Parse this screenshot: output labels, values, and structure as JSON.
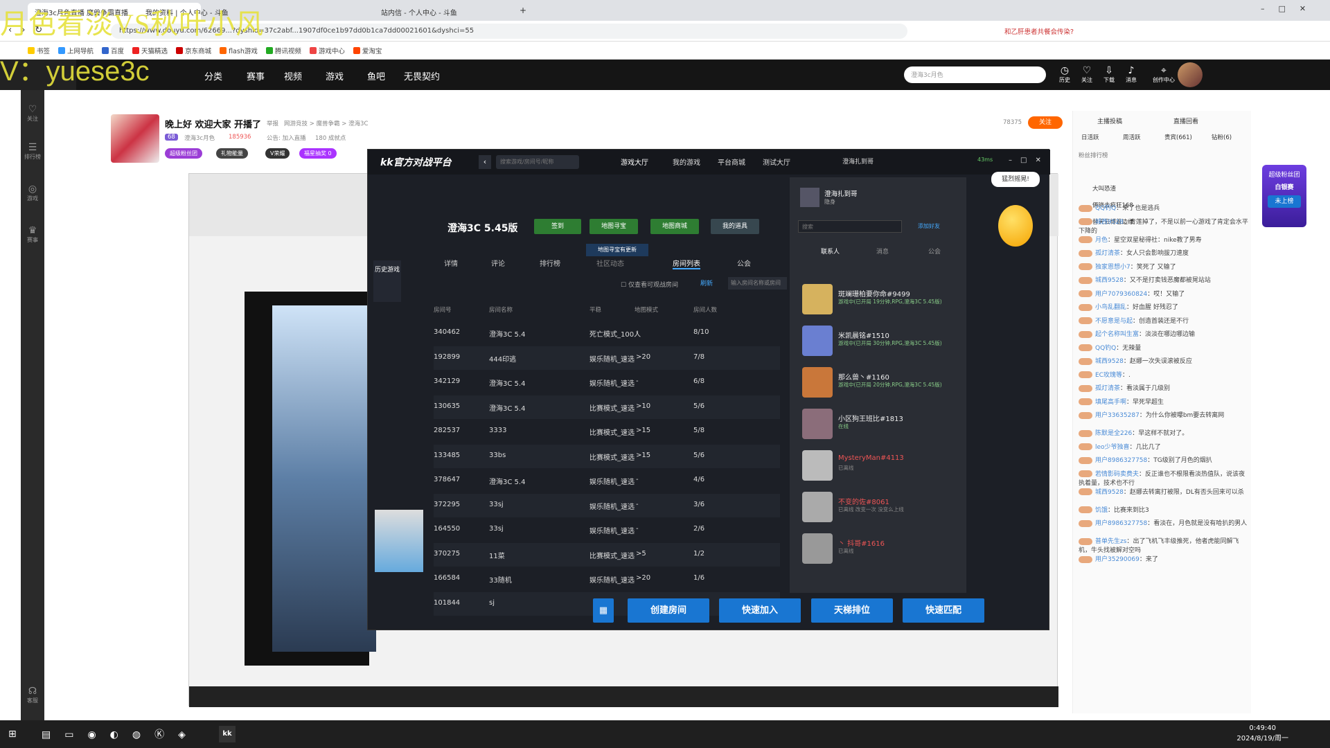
{
  "watermark": {
    "line1": "月色看淡VS秋叶小风",
    "line2": "V：yuese3c"
  },
  "browser": {
    "tabs": [
      "澄海3c月色直播 魔兽争霸直播",
      "我的资料 | 个人中心 - 斗鱼",
      "站内信 - 个人中心 - 斗鱼"
    ],
    "url": "https://www.douyu.com/62669...?dyshid=37c2abf...1907df0ce1b97dd0b1ca7dd00021601&dyshci=55",
    "bookmarks": [
      "书签",
      "上网导航",
      "百度",
      "天猫精选",
      "京东商城",
      "flash游戏",
      "腾讯视频",
      "游戏中心",
      "爱淘宝"
    ],
    "notice": "和乙肝患者共餐会传染?"
  },
  "douyu": {
    "nav": [
      "分类",
      "赛事",
      "视频",
      "游戏",
      "鱼吧",
      "无畏契约"
    ],
    "search_placeholder": "澄海3c月色",
    "header_icons": [
      "历史",
      "关注",
      "下载",
      "消息",
      "创作中心"
    ],
    "left_rail": [
      "关注",
      "排行榜",
      "游戏",
      "赛事",
      "客服"
    ]
  },
  "room": {
    "title": "晚上好 欢迎大家 开播了",
    "report": "举报",
    "category": "网游竞技 > 魔兽争霸 > 澄海3C",
    "level": "68",
    "streamer": "澄海3c月色",
    "hot": "185936",
    "notice": "公告: 加入直播",
    "fans_count": "180 成就点",
    "followers": "78375",
    "follow_btn": "关注",
    "badges": [
      "超级粉丝团",
      "礼物能量",
      "V荣耀",
      "福星抽奖 0"
    ]
  },
  "kk": {
    "logo": "kk官方对战平台",
    "search": "搜索游戏/房间号/昵称",
    "nav": [
      "游戏大厅",
      "我的游戏",
      "平台商城",
      "测试大厅"
    ],
    "user": "澄海扎到哥",
    "ping": "43ms",
    "side_label": "历史游戏",
    "game_title": "澄海3C 5.45版",
    "buttons": [
      "签到",
      "地图寻宝",
      "地图商城",
      "我的道具"
    ],
    "tooltip": "地图寻宝有更新",
    "tabs": [
      "详情",
      "评论",
      "排行榜",
      "社区动态",
      "房间列表",
      "公会"
    ],
    "filter_label": "仅查看可观战房间",
    "refresh": "刷新",
    "filter_input": "输入房间名称或房间",
    "columns": [
      "房间号",
      "房间名称",
      "平稳",
      "地图模式",
      "房间人数",
      "房间号"
    ],
    "rooms": [
      {
        "id": "340462",
        "name": "澄海3C 5.4",
        "mode": "死亡模式_100人",
        "req": "-",
        "count": "8/10"
      },
      {
        "id": "192899",
        "name": "444印逃",
        "mode": "娱乐随机_速选",
        "req": ">20",
        "count": "7/8"
      },
      {
        "id": "342129",
        "name": "澄海3C 5.4",
        "mode": "娱乐随机_速选",
        "req": "-",
        "count": "6/8"
      },
      {
        "id": "130635",
        "name": "澄海3C 5.4",
        "mode": "比赛模式_速选",
        "req": ">10",
        "count": "5/6"
      },
      {
        "id": "282537",
        "name": "3333",
        "mode": "比赛模式_速选",
        "req": ">15",
        "count": "5/8"
      },
      {
        "id": "133485",
        "name": "33bs",
        "mode": "比赛模式_速选",
        "req": ">15",
        "count": "5/6"
      },
      {
        "id": "378647",
        "name": "澄海3C 5.4",
        "mode": "娱乐随机_速选",
        "req": "-",
        "count": "4/6"
      },
      {
        "id": "372295",
        "name": "33sj",
        "mode": "娱乐随机_速选",
        "req": "-",
        "count": "3/6"
      },
      {
        "id": "164550",
        "name": "33sj",
        "mode": "娱乐随机_速选",
        "req": "-",
        "count": "2/6"
      },
      {
        "id": "370275",
        "name": "11菜",
        "mode": "比赛模式_速选",
        "req": ">5",
        "count": "1/2"
      },
      {
        "id": "166584",
        "name": "33随机",
        "mode": "娱乐随机_速选",
        "req": ">20",
        "count": "1/6"
      },
      {
        "id": "101844",
        "name": "sj",
        "mode": "",
        "req": "",
        "count": ""
      }
    ],
    "actions": [
      "创建房间",
      "快速加入",
      "天梯排位",
      "快速匹配"
    ],
    "friends_panel": {
      "user": "澄海扎到哥",
      "status": "隐身",
      "search": "搜索",
      "add": "添加好友",
      "tabs": [
        "联系人",
        "消息",
        "公会"
      ],
      "bubble": "猛烈摇晃!",
      "friends": [
        {
          "name": "斑斓珊柏要你命#9499",
          "status": "游戏中(已开局 19分钟,RPG,澄海3C 5.45版)",
          "online": true
        },
        {
          "name": "米凯晨铭#1510",
          "status": "游戏中(已开局 30分钟,RPG,澄海3C 5.45版)",
          "online": true
        },
        {
          "name": "那么兽丶#1160",
          "status": "游戏中(已开局 20分钟,RPG,澄海3C 5.45版)",
          "online": true
        },
        {
          "name": "小区狗王班比#1813",
          "status": "在线",
          "online": true
        },
        {
          "name": "MysteryMan#4113",
          "status": "已离线",
          "online": false
        },
        {
          "name": "不变的佐#8061",
          "status": "已离线 改变一次 没变么上线",
          "online": false
        },
        {
          "name": "丶 抖哥#1616",
          "status": "已离线",
          "online": false
        }
      ]
    }
  },
  "right": {
    "tabs": [
      "日活跃",
      "周活跃",
      "贵宾(661)",
      "钻粉(6)"
    ],
    "ranks": [
      "主播投稿",
      "直播回看"
    ],
    "rank_title": "粉丝排行榜",
    "rank_list": [
      "大叫恐渣",
      "俩晓去疯狂168",
      "替天云博着边缘"
    ],
    "promo": [
      "超级粉丝团",
      "白银赛",
      "未上榜"
    ],
    "chat": [
      {
        "name": "QQ钓Q",
        "msg": "来了也是逃兵"
      },
      {
        "name": "城西9528",
        "msg": "青莲掉了，不是以前一心游戏了肯定会水平下降的"
      },
      {
        "name": "月色",
        "msg": "星空双星秘得社：nike教了男寿"
      },
      {
        "name": "孤灯清茶",
        "msg": "女人只会影响拔刀速度"
      },
      {
        "name": "独家恩想小7",
        "msg": "笑死了 又输了"
      },
      {
        "name": "城西9528",
        "msg": "又不是打卖钱恶魔都被晃站站"
      },
      {
        "name": "用户7079360824",
        "msg": "哎！又输了"
      },
      {
        "name": "小鸟乱翻乱",
        "msg": "好血腥 好残忍了"
      },
      {
        "name": "不愿意是与起",
        "msg": "创造首装还是不行"
      },
      {
        "name": "起个名称叫生富",
        "msg": "淡淡在哪边哪边输"
      },
      {
        "name": "QQ钓Q",
        "msg": "无辣量"
      },
      {
        "name": "城西9528",
        "msg": "赵娜一次失误滚被反应"
      },
      {
        "name": "EC玫瑰等",
        "msg": "."
      },
      {
        "name": "孤灯清茶",
        "msg": "看淡属于几级别"
      },
      {
        "name": "填尾高手啊",
        "msg": "早死早超生"
      },
      {
        "name": "用户33635287",
        "msg": "为什么你被曝bm要去转离网"
      },
      {
        "name": "陈默是全226",
        "msg": "早这样不就对了。"
      },
      {
        "name": "leo少爷独喜",
        "msg": "几比几了"
      },
      {
        "name": "用户8986327758",
        "msg": "TG级别了月色的烟扒"
      },
      {
        "name": "若情影码卖费夫",
        "msg": "反正谁也不根限看淡热值队，说该夜执着量，技术也不行"
      },
      {
        "name": "城西9528",
        "msg": "赵娜去转离打被限，DL有否头回来可以杀"
      },
      {
        "name": "饥饿",
        "msg": "比赛来到比3"
      },
      {
        "name": "用户8986327758",
        "msg": "看淡在，月色就是没有哈扒的男人"
      },
      {
        "name": "普单先生zs",
        "msg": "出了飞机飞丰级推死，他者虎能同解飞机，牛头找被解对空吗"
      },
      {
        "name": "用户35290069",
        "msg": "来了"
      }
    ]
  },
  "taskbar": {
    "time": "0:49:40",
    "date": "2024/8/19/周一"
  }
}
